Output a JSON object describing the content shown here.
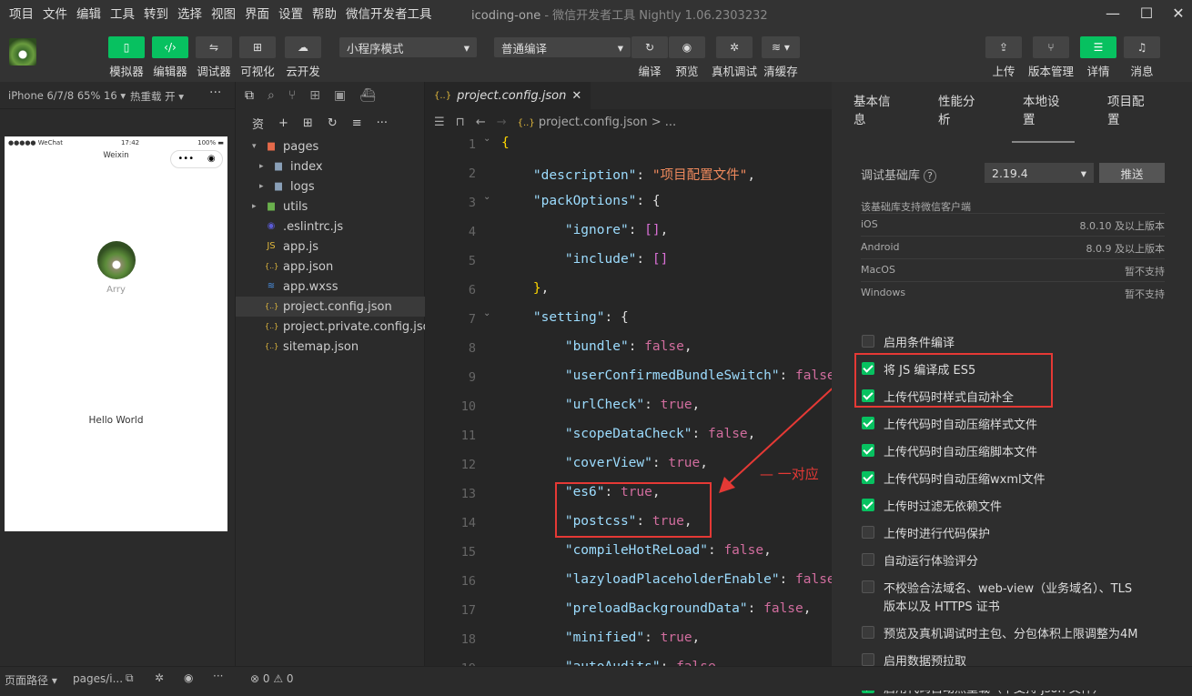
{
  "menu": [
    "项目",
    "文件",
    "编辑",
    "工具",
    "转到",
    "选择",
    "视图",
    "界面",
    "设置",
    "帮助",
    "微信开发者工具"
  ],
  "window": {
    "title": "icoding-one",
    "subtitle": "- 微信开发者工具 Nightly 1.06.2303232"
  },
  "toolbar": {
    "simulator": "模拟器",
    "editor": "编辑器",
    "debugger": "调试器",
    "visual": "可视化",
    "cloud": "云开发",
    "mode": "小程序模式",
    "compile_mode": "普通编译",
    "compile": "编译",
    "preview": "预览",
    "remote_debug": "真机调试",
    "clear_cache": "清缓存",
    "upload": "上传",
    "version": "版本管理",
    "details": "详情",
    "messages": "消息"
  },
  "simulator": {
    "device": "iPhone 6/7/8 65% 16 ▾",
    "hot_reload": "热重载 开 ▾",
    "status_left": "●●●●● WeChat",
    "status_time": "17:42",
    "status_batt": "100%",
    "nav_title": "Weixin",
    "user_name": "Arry",
    "hello": "Hello World"
  },
  "bottombar": {
    "page_path": "页面路径 ▾",
    "path_value": "pages/i...",
    "problems": "⊗ 0 ⚠ 0"
  },
  "explorer": {
    "title": "资",
    "files": [
      {
        "name": "pages",
        "caret": "▾",
        "icon": "folder-red"
      },
      {
        "name": "index",
        "caret": "▸",
        "icon": "folder"
      },
      {
        "name": "logs",
        "caret": "▸",
        "icon": "folder"
      },
      {
        "name": "utils",
        "caret": "▸",
        "icon": "folder-green"
      },
      {
        "name": ".eslintrc.js",
        "caret": "",
        "icon": "eslint"
      },
      {
        "name": "app.js",
        "caret": "",
        "icon": "js"
      },
      {
        "name": "app.json",
        "caret": "",
        "icon": "json"
      },
      {
        "name": "app.wxss",
        "caret": "",
        "icon": "wxss"
      },
      {
        "name": "project.config.json",
        "caret": "",
        "icon": "json",
        "selected": true
      },
      {
        "name": "project.private.config.json",
        "caret": "",
        "icon": "json"
      },
      {
        "name": "sitemap.json",
        "caret": "",
        "icon": "json"
      }
    ]
  },
  "editor": {
    "tab": "project.config.json",
    "breadcrumb": "project.config.json >  ...",
    "lines": [
      {
        "n": "1",
        "t": "{"
      },
      {
        "n": "2",
        "t": "    \"description\": \"项目配置文件\","
      },
      {
        "n": "3",
        "t": "    \"packOptions\": {"
      },
      {
        "n": "4",
        "t": "        \"ignore\": [],"
      },
      {
        "n": "5",
        "t": "        \"include\": []"
      },
      {
        "n": "6",
        "t": "    },"
      },
      {
        "n": "7",
        "t": "    \"setting\": {"
      },
      {
        "n": "8",
        "t": "        \"bundle\": false,"
      },
      {
        "n": "9",
        "t": "        \"userConfirmedBundleSwitch\": false"
      },
      {
        "n": "10",
        "t": "        \"urlCheck\": true,"
      },
      {
        "n": "11",
        "t": "        \"scopeDataCheck\": false,"
      },
      {
        "n": "12",
        "t": "        \"coverView\": true,"
      },
      {
        "n": "13",
        "t": "        \"es6\": true,"
      },
      {
        "n": "14",
        "t": "        \"postcss\": true,"
      },
      {
        "n": "15",
        "t": "        \"compileHotReLoad\": false,"
      },
      {
        "n": "16",
        "t": "        \"lazyloadPlaceholderEnable\": false"
      },
      {
        "n": "17",
        "t": "        \"preloadBackgroundData\": false,"
      },
      {
        "n": "18",
        "t": "        \"minified\": true,"
      },
      {
        "n": "19",
        "t": "        \"autoAudits\": false,"
      }
    ],
    "annotation": "— 一对应"
  },
  "details": {
    "tabs": [
      "基本信息",
      "性能分析",
      "本地设置",
      "项目配置"
    ],
    "active_tab": "本地设置",
    "base_lib_label": "调试基础库",
    "base_lib_value": "2.19.4",
    "push": "推送",
    "support_text": "该基础库支持微信客户端",
    "platforms": [
      {
        "os": "iOS",
        "req": "8.0.10 及以上版本"
      },
      {
        "os": "Android",
        "req": "8.0.9 及以上版本"
      },
      {
        "os": "MacOS",
        "req": "暂不支持"
      },
      {
        "os": "Windows",
        "req": "暂不支持"
      }
    ],
    "options": [
      {
        "label": "启用条件编译",
        "checked": false
      },
      {
        "label": "将 JS 编译成 ES5",
        "checked": true
      },
      {
        "label": "上传代码时样式自动补全",
        "checked": true
      },
      {
        "label": "上传代码时自动压缩样式文件",
        "checked": true
      },
      {
        "label": "上传代码时自动压缩脚本文件",
        "checked": true
      },
      {
        "label": "上传代码时自动压缩wxml文件",
        "checked": true
      },
      {
        "label": "上传时过滤无依赖文件",
        "checked": true
      },
      {
        "label": "上传时进行代码保护",
        "checked": false
      },
      {
        "label": "自动运行体验评分",
        "checked": false
      },
      {
        "label": "不校验合法域名、web-view（业务域名）、TLS",
        "label2": "版本以及 HTTPS 证书",
        "checked": false
      },
      {
        "label": "预览及真机调试时主包、分包体积上限调整为4M",
        "checked": false
      },
      {
        "label": "启用数据预拉取",
        "checked": false
      },
      {
        "label": "启用代码自动热重载（不支持 json 文件）",
        "checked": true
      }
    ]
  },
  "colors": {
    "accent": "#07c160",
    "highlight": "#e53935"
  }
}
